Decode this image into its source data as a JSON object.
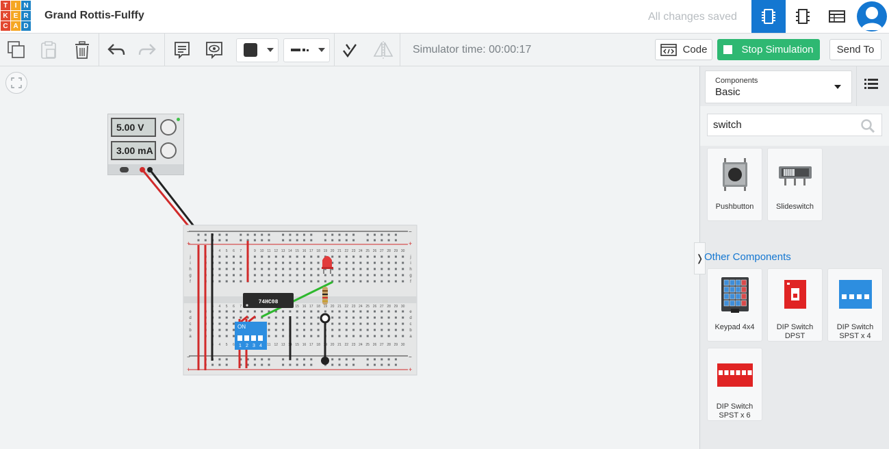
{
  "app": {
    "logo_letters": [
      "T",
      "I",
      "N",
      "K",
      "E",
      "R",
      "C",
      "A",
      "D"
    ],
    "logo_colors": [
      "#e2482f",
      "#f5a623",
      "#1d83c6",
      "#e2482f",
      "#f5a623",
      "#1d83c6",
      "#e2482f",
      "#f5a623",
      "#1d83c6"
    ],
    "project_title": "Grand Rottis-Fulffy",
    "save_status": "All changes saved",
    "views": [
      {
        "name": "circuit-view-icon",
        "active": true
      },
      {
        "name": "schematic-view-icon",
        "active": false
      },
      {
        "name": "component-list-icon",
        "active": false
      }
    ]
  },
  "toolbar": {
    "sim_time": "Simulator time: 00:00:17",
    "code_label": "Code",
    "stop_label": "Stop Simulation",
    "send_label": "Send To",
    "accent_green": "#2eb872"
  },
  "power_supply": {
    "voltage": "5.00 V",
    "current": "3.00 mA"
  },
  "breadboard": {
    "chip_label": "74HC08",
    "dip_label": "ON",
    "dip_numbers": [
      "1",
      "2",
      "3",
      "4"
    ],
    "col_numbers": [
      "1",
      "2",
      "3",
      "4",
      "5",
      "6",
      "7",
      "8",
      "9",
      "10",
      "11",
      "12",
      "13",
      "14",
      "15",
      "16",
      "17",
      "18",
      "19",
      "20",
      "21",
      "22",
      "23",
      "24",
      "25",
      "26",
      "27",
      "28",
      "29",
      "30"
    ],
    "row_letters_top": [
      "j",
      "i",
      "h",
      "g",
      "f"
    ],
    "row_letters_bottom": [
      "e",
      "d",
      "c",
      "b",
      "a"
    ],
    "rail_plus": "+",
    "rail_minus": "−"
  },
  "panel": {
    "dropdown_caption": "Components",
    "dropdown_value": "Basic",
    "search_value": "switch",
    "other_heading": "Other Components",
    "basic_items": [
      {
        "label": "Pushbutton"
      },
      {
        "label": "Slideswitch"
      }
    ],
    "other_items": [
      {
        "label": "Keypad 4x4"
      },
      {
        "label": "DIP Switch DPST"
      },
      {
        "label": "DIP Switch SPST x 4"
      },
      {
        "label": "DIP Switch SPST x 6"
      }
    ]
  }
}
